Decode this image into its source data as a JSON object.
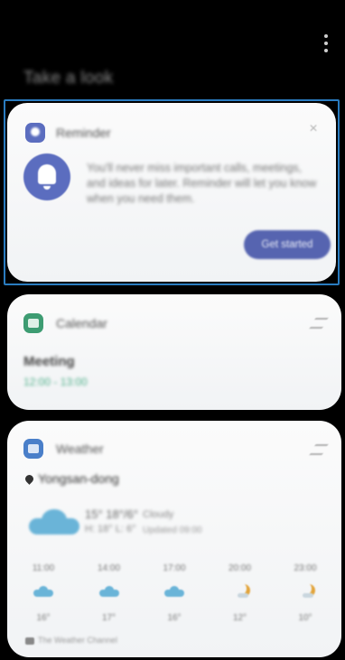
{
  "header": {
    "title": "Take a look"
  },
  "reminder_card": {
    "title": "Reminder",
    "message": "You'll never miss important calls, meetings, and ideas for later. Reminder will let you know when you need them.",
    "button": "Get started"
  },
  "calendar_card": {
    "title": "Calendar",
    "event_title": "Meeting",
    "event_time": "12:00 - 13:00"
  },
  "weather_card": {
    "title": "Weather",
    "location": "Yongsan-dong",
    "current_temp": "15° 18°/6°",
    "condition": "Cloudy",
    "hi_lo": "H: 18° L: 6°",
    "updated": "Updated 09:00",
    "forecast": [
      {
        "time": "11:00",
        "icon": "cloud-icon",
        "temp": "16°"
      },
      {
        "time": "14:00",
        "icon": "cloud-icon",
        "temp": "17°"
      },
      {
        "time": "17:00",
        "icon": "cloud-icon",
        "temp": "16°"
      },
      {
        "time": "20:00",
        "icon": "moon-icon",
        "temp": "12°"
      },
      {
        "time": "23:00",
        "icon": "moon-icon",
        "temp": "10°"
      }
    ],
    "source": "The Weather Channel"
  }
}
